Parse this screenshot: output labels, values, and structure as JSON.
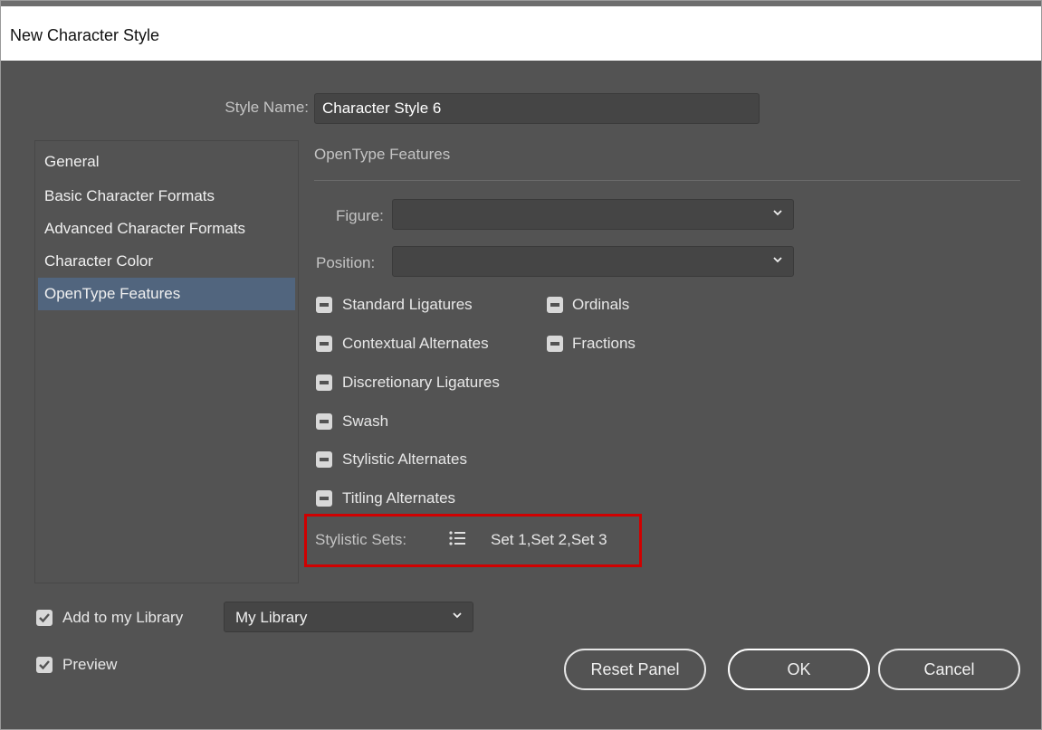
{
  "dialog": {
    "title": "New Character Style"
  },
  "style_name": {
    "label": "Style Name:",
    "value": "Character Style 6"
  },
  "nav": {
    "items": [
      {
        "label": "General",
        "active": false
      },
      {
        "label": "Basic Character Formats",
        "active": false
      },
      {
        "label": "Advanced Character Formats",
        "active": false
      },
      {
        "label": "Character Color",
        "active": false
      },
      {
        "label": "OpenType Features",
        "active": true
      }
    ]
  },
  "section": {
    "title": "OpenType Features"
  },
  "figure": {
    "label": "Figure:",
    "value": ""
  },
  "position": {
    "label": "Position:",
    "value": ""
  },
  "features": {
    "standard_ligatures": "Standard Ligatures",
    "ordinals": "Ordinals",
    "contextual_alternates": "Contextual Alternates",
    "fractions": "Fractions",
    "discretionary_ligatures": "Discretionary Ligatures",
    "swash": "Swash",
    "stylistic_alternates": "Stylistic Alternates",
    "titling_alternates": "Titling Alternates"
  },
  "stylistic_sets": {
    "label": "Stylistic Sets:",
    "value": "Set 1,Set 2,Set 3",
    "icon": "list-icon"
  },
  "library": {
    "checkbox_label": "Add to my Library",
    "checked": true,
    "selected": "My Library"
  },
  "preview": {
    "label": "Preview",
    "checked": true
  },
  "buttons": {
    "reset": "Reset Panel",
    "ok": "OK",
    "cancel": "Cancel"
  },
  "colors": {
    "accent_selected": "#51657e",
    "highlight": "#d00000",
    "background": "#535353"
  }
}
